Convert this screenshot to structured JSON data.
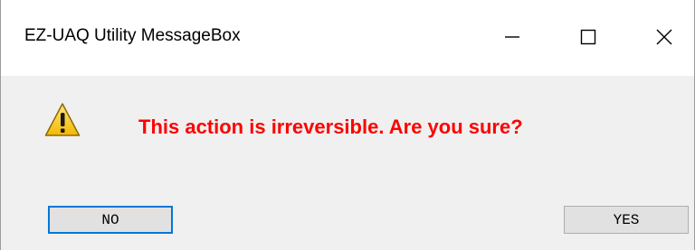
{
  "window": {
    "title": "EZ-UAQ Utility MessageBox",
    "controls": {
      "minimize_icon": "minimize-icon",
      "maximize_icon": "maximize-icon",
      "close_icon": "close-icon"
    }
  },
  "dialog": {
    "icon": "warning-icon",
    "message": "This action is irreversible. Are you sure?",
    "message_color": "#ff0000",
    "buttons": {
      "no_label": "NO",
      "yes_label": "YES"
    },
    "focused_button": "NO",
    "focus_color": "#0078d7"
  }
}
